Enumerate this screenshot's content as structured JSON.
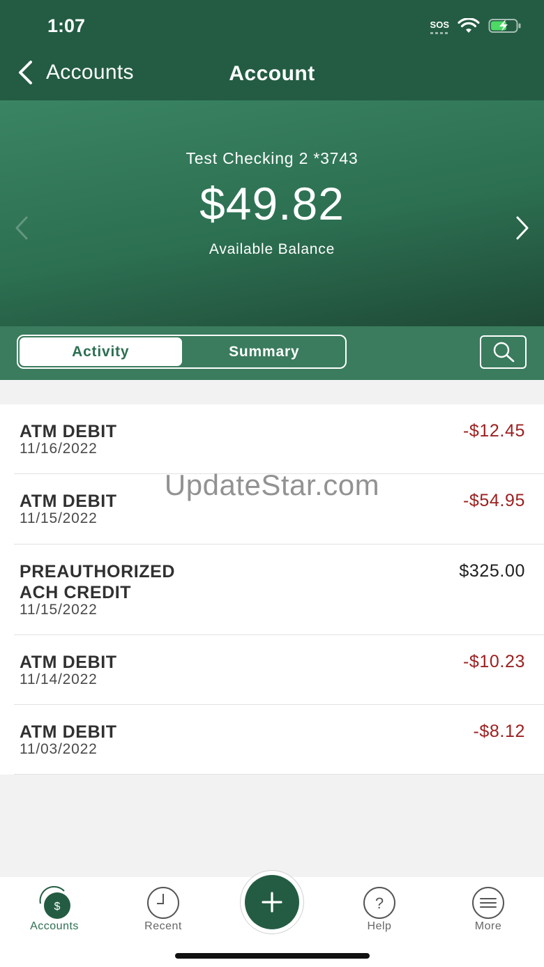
{
  "status": {
    "time": "1:07",
    "sos": "SOS"
  },
  "nav": {
    "back_label": "Accounts",
    "title": "Account"
  },
  "account": {
    "name": "Test Checking 2 *3743",
    "balance": "$49.82",
    "balance_label": "Available Balance"
  },
  "tabs": [
    {
      "label": "Activity",
      "active": true
    },
    {
      "label": "Summary",
      "active": false
    }
  ],
  "transactions": [
    {
      "description": "ATM DEBIT",
      "date": "11/16/2022",
      "amount": "-$12.45"
    },
    {
      "description": "ATM DEBIT",
      "date": "11/15/2022",
      "amount": "-$54.95"
    },
    {
      "description": "PREAUTHORIZED\nACH CREDIT",
      "date": "11/15/2022",
      "amount": "$325.00"
    },
    {
      "description": "ATM DEBIT",
      "date": "11/14/2022",
      "amount": "-$10.23"
    },
    {
      "description": "ATM DEBIT",
      "date": "11/03/2022",
      "amount": "-$8.12"
    }
  ],
  "watermark": "UpdateStar.com",
  "bottom_nav": {
    "accounts": {
      "label": "Accounts",
      "icon": "accounts-dollar-icon",
      "glyph": "$"
    },
    "recent": {
      "label": "Recent",
      "icon": "clock-icon"
    },
    "add": {
      "icon": "plus-icon"
    },
    "help": {
      "label": "Help",
      "icon": "help-icon",
      "glyph": "?"
    },
    "more": {
      "label": "More",
      "icon": "menu-icon"
    }
  },
  "colors": {
    "brand_green": "#235c43",
    "hero_green": "#2c6f51",
    "negative_amount": "#9c2020"
  }
}
